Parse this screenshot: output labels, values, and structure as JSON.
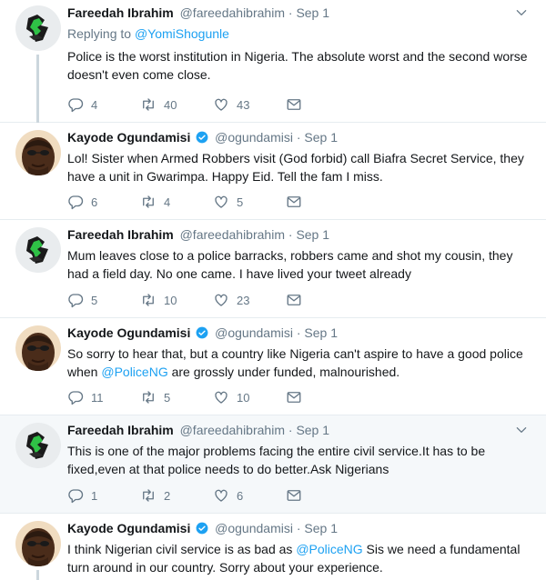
{
  "tweets": [
    {
      "name": "Fareedah Ibrahim",
      "handle": "@fareedahibrahim",
      "dot": "·",
      "time": "Sep 1",
      "verified": false,
      "replying_label": "Replying to",
      "replying_handle": "@YomiShogunle",
      "text_parts": [
        "Police is the worst institution in Nigeria. The absolute worst and the second worse doesn't even come close."
      ],
      "reply_count": "4",
      "retweet_count": "40",
      "like_count": "43"
    },
    {
      "name": "Kayode Ogundamisi",
      "handle": "@ogundamisi",
      "dot": "·",
      "time": "Sep 1",
      "verified": true,
      "text_parts": [
        "Lol! Sister when Armed Robbers visit  (God forbid) call Biafra Secret Service, they have a unit in Gwarimpa. Happy Eid. Tell the fam I miss."
      ],
      "reply_count": "6",
      "retweet_count": "4",
      "like_count": "5"
    },
    {
      "name": "Fareedah Ibrahim",
      "handle": "@fareedahibrahim",
      "dot": "·",
      "time": "Sep 1",
      "verified": false,
      "text_parts": [
        "Mum leaves close to a police barracks, robbers came and shot my cousin, they had a field day. No one came. I have lived your tweet already"
      ],
      "reply_count": "5",
      "retweet_count": "10",
      "like_count": "23"
    },
    {
      "name": "Kayode Ogundamisi",
      "handle": "@ogundamisi",
      "dot": "·",
      "time": "Sep 1",
      "verified": true,
      "text_parts": [
        "So sorry to hear that, but a country like Nigeria can't aspire to have a good police when ",
        "@PoliceNG",
        " are grossly under funded, malnourished."
      ],
      "reply_count": "11",
      "retweet_count": "5",
      "like_count": "10"
    },
    {
      "name": "Fareedah Ibrahim",
      "handle": "@fareedahibrahim",
      "dot": "·",
      "time": "Sep 1",
      "verified": false,
      "text_parts": [
        "This is one of the major problems facing the entire civil service.It has to be fixed,even at that police needs to do better.Ask Nigerians"
      ],
      "reply_count": "1",
      "retweet_count": "2",
      "like_count": "6"
    },
    {
      "name": "Kayode Ogundamisi",
      "handle": "@ogundamisi",
      "dot": "·",
      "time": "Sep 1",
      "verified": true,
      "text_parts": [
        "I think Nigerian civil service is as bad as ",
        "@PoliceNG",
        " Sis we need a fundamental turn around in our country. Sorry about your experience."
      ]
    }
  ],
  "colors": {
    "link": "#1da1f2",
    "secondary": "#657786",
    "thread_line": "#ccd6dd",
    "highlight_bg": "#f5f8fa"
  }
}
